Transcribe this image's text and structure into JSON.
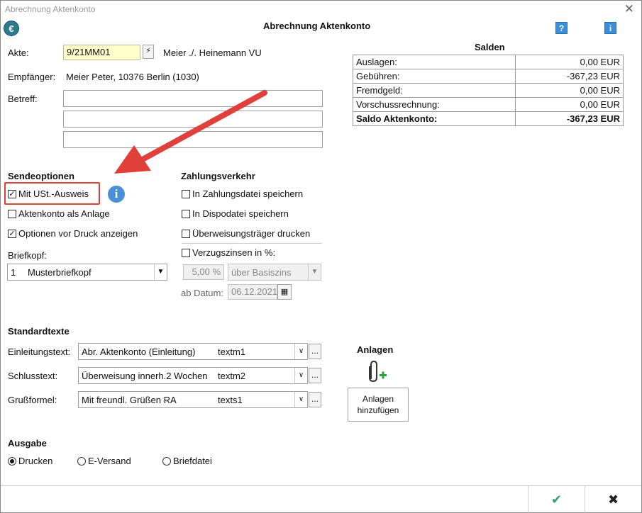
{
  "window": {
    "title": "Abrechnung Aktenkonto",
    "close": "✕"
  },
  "header": {
    "title": "Abrechnung Aktenkonto",
    "help": "?",
    "info": "i"
  },
  "akte": {
    "label": "Akte:",
    "value": "9/21MM01",
    "name": "Meier ./. Heinemann VU"
  },
  "empfaenger": {
    "label": "Empfänger:",
    "value": "Meier Peter, 10376 Berlin (1030)"
  },
  "betreff": {
    "label": "Betreff:",
    "lines": [
      "",
      "",
      ""
    ]
  },
  "salden": {
    "title": "Salden",
    "rows": [
      {
        "label": "Auslagen:",
        "value": "0,00 EUR"
      },
      {
        "label": "Gebühren:",
        "value": "-367,23 EUR"
      },
      {
        "label": "Fremdgeld:",
        "value": "0,00 EUR"
      },
      {
        "label": "Vorschussrechnung:",
        "value": "0,00 EUR"
      }
    ],
    "total": {
      "label": "Saldo Aktenkonto:",
      "value": "-367,23 EUR"
    }
  },
  "sendeoptionen": {
    "title": "Sendeoptionen",
    "mit_ust": {
      "label": "Mit USt.-Ausweis",
      "checked": true
    },
    "aktenkonto_anlage": {
      "label": "Aktenkonto als Anlage",
      "checked": false
    },
    "optionen_druck": {
      "label": "Optionen vor Druck anzeigen",
      "checked": true
    }
  },
  "briefkopf": {
    "label": "Briefkopf:",
    "number": "1",
    "value": "Musterbriefkopf"
  },
  "zahlungsverkehr": {
    "title": "Zahlungsverkehr",
    "zahlungsdatei": {
      "label": "In Zahlungsdatei speichern",
      "checked": false
    },
    "dispodatei": {
      "label": "In Dispodatei speichern",
      "checked": false
    },
    "ueberweisung": {
      "label": "Überweisungsträger drucken",
      "checked": false
    },
    "verzugszinsen": {
      "label": "Verzugszinsen in %:",
      "checked": false
    },
    "zins_value": "5,00 %",
    "zins_basis": "über Basiszins",
    "ab_datum_label": "ab Datum:",
    "ab_datum": "06.12.2021"
  },
  "standardtexte": {
    "title": "Standardtexte",
    "einleitung": {
      "label": "Einleitungstext:",
      "value": "Abr. Aktenkonto (Einleitung)",
      "code": "textm1"
    },
    "schluss": {
      "label": "Schlusstext:",
      "value": "Überweisung innerh.2 Wochen",
      "code": "textm2"
    },
    "gruss": {
      "label": "Grußformel:",
      "value": "Mit freundl. Grüßen RA",
      "code": "texts1"
    },
    "dots": "..."
  },
  "anlagen": {
    "title": "Anlagen",
    "button_line1": "Anlagen",
    "button_line2": "hinzufügen"
  },
  "ausgabe": {
    "title": "Ausgabe",
    "options": [
      {
        "label": "Drucken",
        "selected": true
      },
      {
        "label": "E-Versand",
        "selected": false
      },
      {
        "label": "Briefdatei",
        "selected": false
      }
    ]
  },
  "footer": {
    "ok": "✔",
    "cancel": "✖"
  },
  "colors": {
    "highlight": "#e0403a",
    "arrow": "#e0403a",
    "akte_field": "#ffffcc",
    "ok": "#3a9a7a"
  }
}
